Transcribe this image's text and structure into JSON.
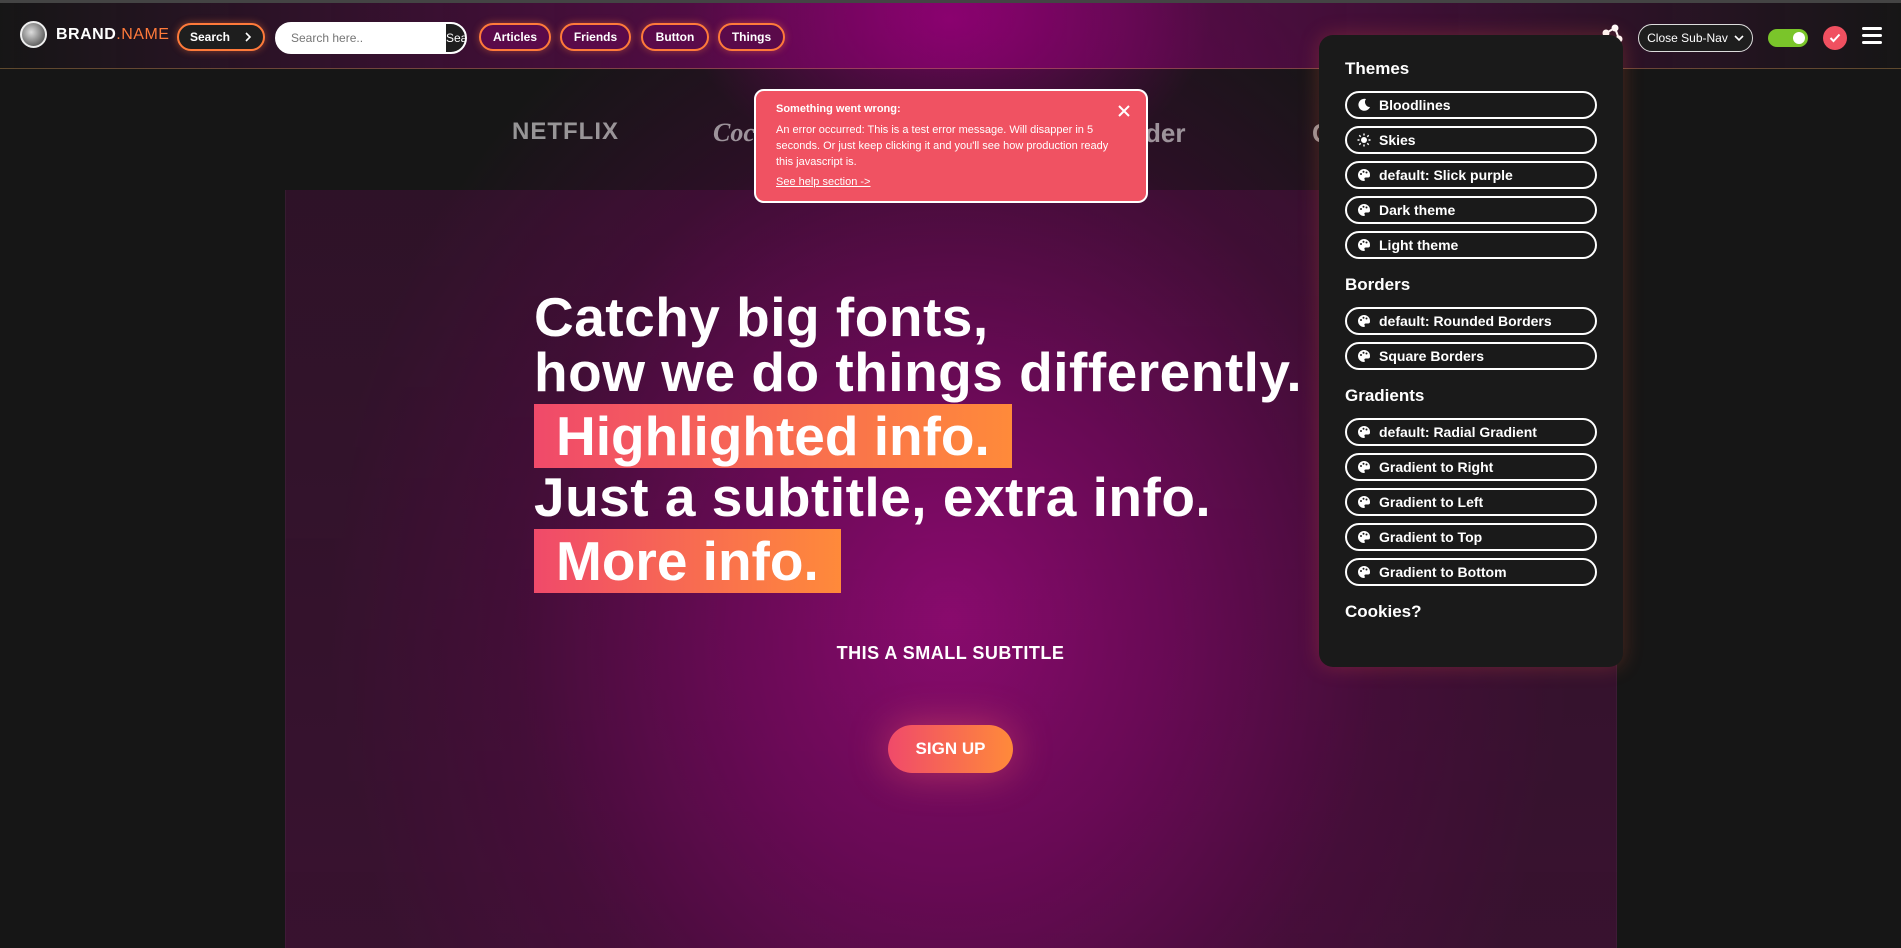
{
  "header": {
    "brand": {
      "part1": "BRAND",
      "part2": ".NAME"
    },
    "search_pill": "Search",
    "search_placeholder": "Search here..",
    "search_button": "Search",
    "nav": [
      "Articles",
      "Friends",
      "Button",
      "Things"
    ],
    "subnav_button": "Close Sub-Nav",
    "toggle_on": true
  },
  "logos": [
    "NETFLIX",
    "Coca",
    "der",
    "G"
  ],
  "toast": {
    "title": "Something went wrong:",
    "message": "An error occurred: This is a test error message. Will disapper in 5 seconds. Or just keep clicking it and you'll see how production ready this javascript is.",
    "link": "See help section ->"
  },
  "hero": {
    "line1": "Catchy big fonts,",
    "line2": "how we do things differently.",
    "highlight1": "Highlighted info.",
    "line3": "Just a subtitle, extra info.",
    "highlight2": "More info.",
    "subtitle": "THIS A SMALL SUBTITLE",
    "cta": "SIGN UP"
  },
  "menu": {
    "themes_title": "Themes",
    "themes": [
      "Bloodlines",
      "Skies",
      "default: Slick purple",
      "Dark theme",
      "Light theme"
    ],
    "borders_title": "Borders",
    "borders": [
      "default: Rounded Borders",
      "Square Borders"
    ],
    "gradients_title": "Gradients",
    "gradients": [
      "default: Radial Gradient",
      "Gradient to Right",
      "Gradient to Left",
      "Gradient to Top",
      "Gradient to Bottom"
    ],
    "cookies_title": "Cookies?"
  },
  "colors": {
    "accent": "#ff7a3a",
    "error": "#f05262",
    "toggle": "#7ac52a",
    "menu_bg": "#1a1a1a"
  }
}
